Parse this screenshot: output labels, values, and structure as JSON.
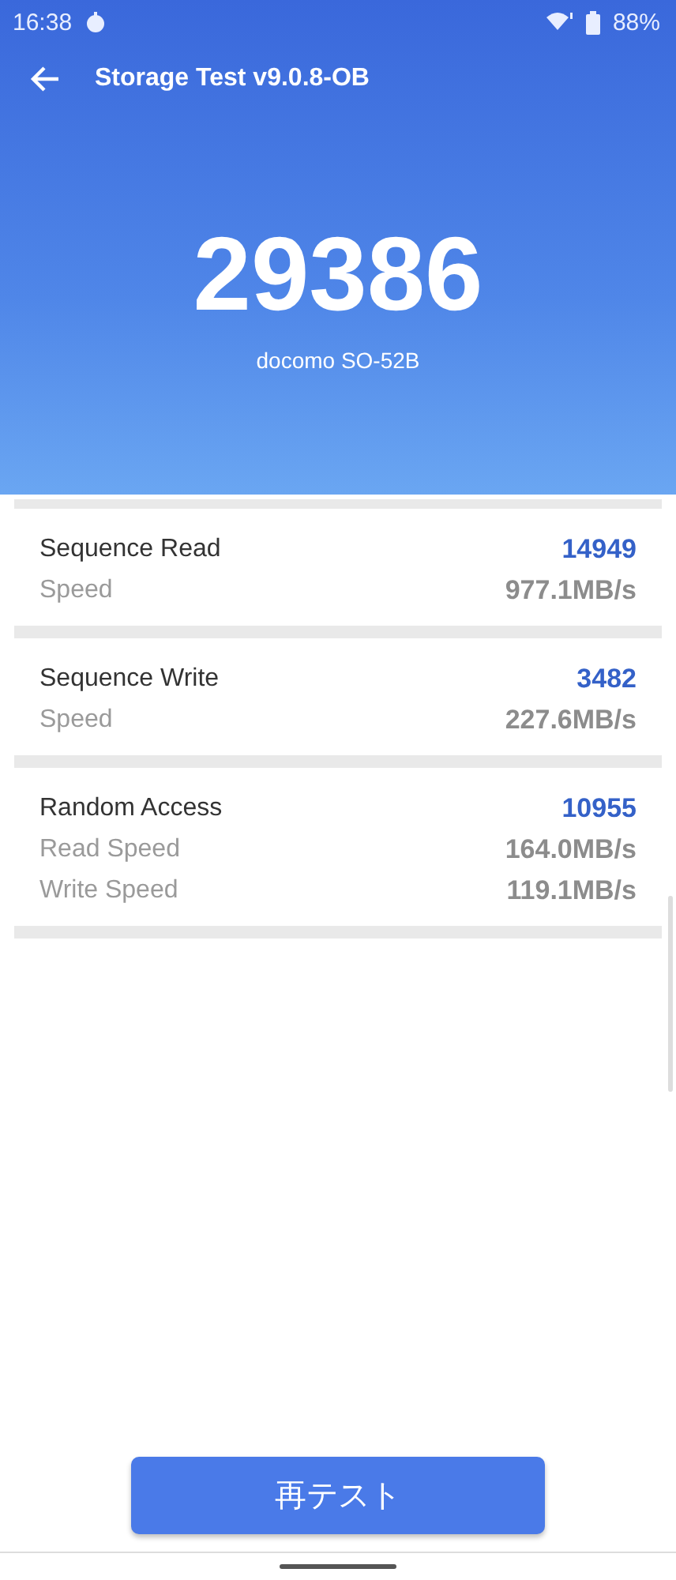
{
  "status_bar": {
    "time": "16:38",
    "battery": "88%"
  },
  "app_bar": {
    "title": "Storage Test v9.0.8-OB"
  },
  "summary": {
    "score": "29386",
    "device": "docomo SO-52B"
  },
  "results": [
    {
      "title": "Sequence Read",
      "score": "14949",
      "rows": [
        {
          "label": "Speed",
          "value": "977.1MB/s"
        }
      ]
    },
    {
      "title": "Sequence Write",
      "score": "3482",
      "rows": [
        {
          "label": "Speed",
          "value": "227.6MB/s"
        }
      ]
    },
    {
      "title": "Random Access",
      "score": "10955",
      "rows": [
        {
          "label": "Read Speed",
          "value": "164.0MB/s"
        },
        {
          "label": "Write Speed",
          "value": "119.1MB/s"
        }
      ]
    }
  ],
  "retest_button": {
    "label": "再テスト"
  }
}
